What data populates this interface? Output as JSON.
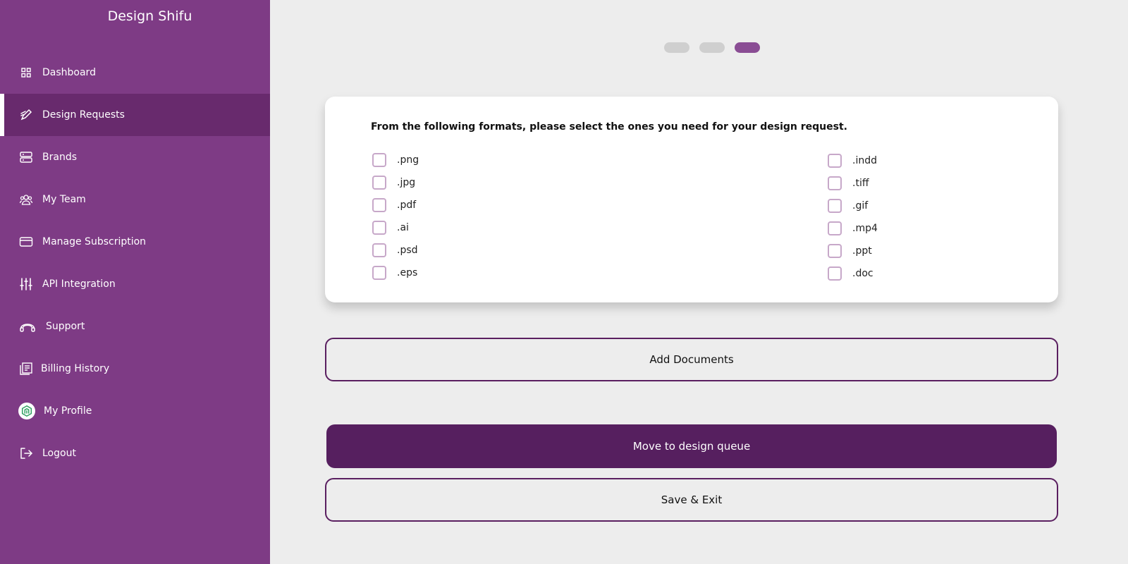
{
  "app": {
    "brand": "Design Shifu"
  },
  "sidebar": {
    "items": [
      {
        "label": "Dashboard",
        "icon": "grid-icon"
      },
      {
        "label": "Design Requests",
        "icon": "pen-icon",
        "active": true
      },
      {
        "label": "Brands",
        "icon": "server-icon"
      },
      {
        "label": "My Team",
        "icon": "team-icon"
      },
      {
        "label": "Manage Subscription",
        "icon": "card-icon"
      },
      {
        "label": "API Integration",
        "icon": "sliders-icon"
      },
      {
        "label": "Support",
        "icon": "headset-icon"
      },
      {
        "label": "Billing History",
        "icon": "receipt-icon"
      },
      {
        "label": "My Profile",
        "icon": "avatar-icon"
      },
      {
        "label": "Logout",
        "icon": "logout-icon"
      }
    ]
  },
  "steps": {
    "total": 3,
    "current": 3
  },
  "form": {
    "question": "From the following formats, please select the ones you need for your design request.",
    "left_options": [
      ".png",
      ".jpg",
      ".pdf",
      ".ai",
      ".psd",
      ".eps"
    ],
    "right_options": [
      ".indd",
      ".tiff",
      ".gif",
      ".mp4",
      ".ppt",
      ".doc"
    ]
  },
  "buttons": {
    "add_documents": "Add Documents",
    "move_queue": "Move to design queue",
    "save_exit": "Save & Exit"
  },
  "colors": {
    "sidebar": "#7e3b85",
    "sidebar_active": "#682a6d",
    "primary": "#561f5f",
    "step_active": "#8a4d94",
    "checkbox_border": "#c7a8c9"
  }
}
